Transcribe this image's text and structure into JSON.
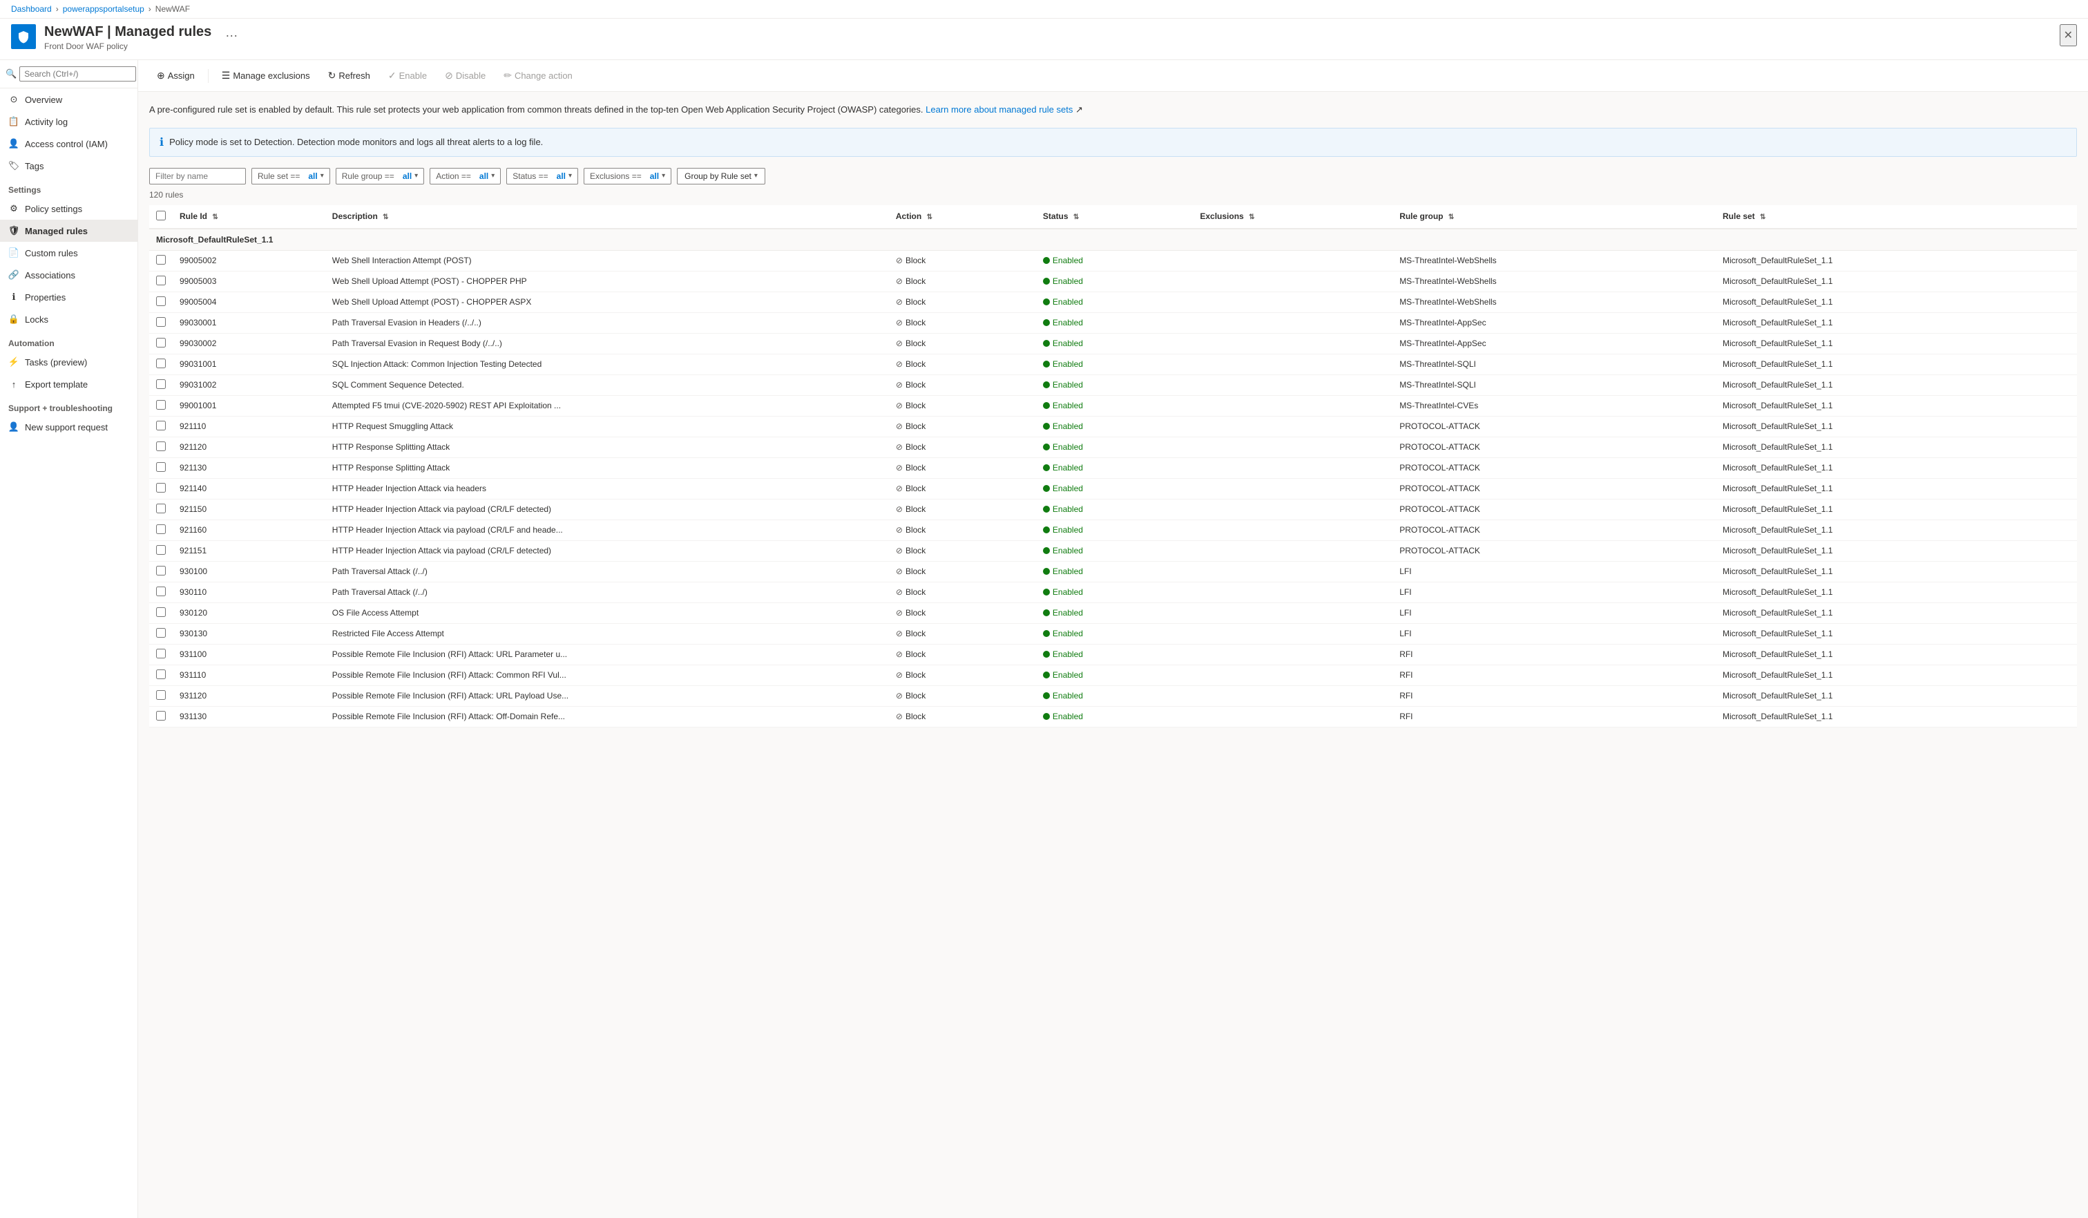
{
  "breadcrumb": {
    "items": [
      "Dashboard",
      "powerappsportalsetup",
      "NewWAF"
    ]
  },
  "header": {
    "title": "NewWAF | Managed rules",
    "subtitle": "Front Door WAF policy",
    "menu_dots": "···"
  },
  "search": {
    "placeholder": "Search (Ctrl+/)"
  },
  "toolbar": {
    "assign_label": "Assign",
    "manage_exclusions_label": "Manage exclusions",
    "refresh_label": "Refresh",
    "enable_label": "Enable",
    "disable_label": "Disable",
    "change_action_label": "Change action"
  },
  "info": {
    "description": "A pre-configured rule set is enabled by default. This rule set protects your web application from common threats defined in the top-ten Open Web Application Security Project (OWASP) categories.",
    "link_text": "Learn more about managed rule sets",
    "alert_text": "Policy mode is set to Detection. Detection mode monitors and logs all threat alerts to a log file."
  },
  "filters": {
    "filter_placeholder": "Filter by name",
    "rule_set_label": "Rule set ==",
    "rule_set_value": "all",
    "rule_group_label": "Rule group ==",
    "rule_group_value": "all",
    "action_label": "Action ==",
    "action_value": "all",
    "status_label": "Status ==",
    "status_value": "all",
    "exclusions_label": "Exclusions ==",
    "exclusions_value": "all",
    "group_by_label": "Group by Rule set"
  },
  "table": {
    "count_text": "120 rules",
    "columns": [
      "Rule Id",
      "Description",
      "Action",
      "Status",
      "Exclusions",
      "Rule group",
      "Rule set"
    ],
    "group_header": "Microsoft_DefaultRuleSet_1.1",
    "rows": [
      {
        "id": "99005002",
        "description": "Web Shell Interaction Attempt (POST)",
        "action": "Block",
        "status": "Enabled",
        "exclusions": "",
        "rule_group": "MS-ThreatIntel-WebShells",
        "rule_set": "Microsoft_DefaultRuleSet_1.1"
      },
      {
        "id": "99005003",
        "description": "Web Shell Upload Attempt (POST) - CHOPPER PHP",
        "action": "Block",
        "status": "Enabled",
        "exclusions": "",
        "rule_group": "MS-ThreatIntel-WebShells",
        "rule_set": "Microsoft_DefaultRuleSet_1.1"
      },
      {
        "id": "99005004",
        "description": "Web Shell Upload Attempt (POST) - CHOPPER ASPX",
        "action": "Block",
        "status": "Enabled",
        "exclusions": "",
        "rule_group": "MS-ThreatIntel-WebShells",
        "rule_set": "Microsoft_DefaultRuleSet_1.1"
      },
      {
        "id": "99030001",
        "description": "Path Traversal Evasion in Headers (/../..)",
        "action": "Block",
        "status": "Enabled",
        "exclusions": "",
        "rule_group": "MS-ThreatIntel-AppSec",
        "rule_set": "Microsoft_DefaultRuleSet_1.1"
      },
      {
        "id": "99030002",
        "description": "Path Traversal Evasion in Request Body (/../..)",
        "action": "Block",
        "status": "Enabled",
        "exclusions": "",
        "rule_group": "MS-ThreatIntel-AppSec",
        "rule_set": "Microsoft_DefaultRuleSet_1.1"
      },
      {
        "id": "99031001",
        "description": "SQL Injection Attack: Common Injection Testing Detected",
        "action": "Block",
        "status": "Enabled",
        "exclusions": "",
        "rule_group": "MS-ThreatIntel-SQLI",
        "rule_set": "Microsoft_DefaultRuleSet_1.1"
      },
      {
        "id": "99031002",
        "description": "SQL Comment Sequence Detected.",
        "action": "Block",
        "status": "Enabled",
        "exclusions": "",
        "rule_group": "MS-ThreatIntel-SQLI",
        "rule_set": "Microsoft_DefaultRuleSet_1.1"
      },
      {
        "id": "99001001",
        "description": "Attempted F5 tmui (CVE-2020-5902) REST API Exploitation ...",
        "action": "Block",
        "status": "Enabled",
        "exclusions": "",
        "rule_group": "MS-ThreatIntel-CVEs",
        "rule_set": "Microsoft_DefaultRuleSet_1.1"
      },
      {
        "id": "921110",
        "description": "HTTP Request Smuggling Attack",
        "action": "Block",
        "status": "Enabled",
        "exclusions": "",
        "rule_group": "PROTOCOL-ATTACK",
        "rule_set": "Microsoft_DefaultRuleSet_1.1"
      },
      {
        "id": "921120",
        "description": "HTTP Response Splitting Attack",
        "action": "Block",
        "status": "Enabled",
        "exclusions": "",
        "rule_group": "PROTOCOL-ATTACK",
        "rule_set": "Microsoft_DefaultRuleSet_1.1"
      },
      {
        "id": "921130",
        "description": "HTTP Response Splitting Attack",
        "action": "Block",
        "status": "Enabled",
        "exclusions": "",
        "rule_group": "PROTOCOL-ATTACK",
        "rule_set": "Microsoft_DefaultRuleSet_1.1"
      },
      {
        "id": "921140",
        "description": "HTTP Header Injection Attack via headers",
        "action": "Block",
        "status": "Enabled",
        "exclusions": "",
        "rule_group": "PROTOCOL-ATTACK",
        "rule_set": "Microsoft_DefaultRuleSet_1.1"
      },
      {
        "id": "921150",
        "description": "HTTP Header Injection Attack via payload (CR/LF detected)",
        "action": "Block",
        "status": "Enabled",
        "exclusions": "",
        "rule_group": "PROTOCOL-ATTACK",
        "rule_set": "Microsoft_DefaultRuleSet_1.1"
      },
      {
        "id": "921160",
        "description": "HTTP Header Injection Attack via payload (CR/LF and heade...",
        "action": "Block",
        "status": "Enabled",
        "exclusions": "",
        "rule_group": "PROTOCOL-ATTACK",
        "rule_set": "Microsoft_DefaultRuleSet_1.1"
      },
      {
        "id": "921151",
        "description": "HTTP Header Injection Attack via payload (CR/LF detected)",
        "action": "Block",
        "status": "Enabled",
        "exclusions": "",
        "rule_group": "PROTOCOL-ATTACK",
        "rule_set": "Microsoft_DefaultRuleSet_1.1"
      },
      {
        "id": "930100",
        "description": "Path Traversal Attack (/../)",
        "action": "Block",
        "status": "Enabled",
        "exclusions": "",
        "rule_group": "LFI",
        "rule_set": "Microsoft_DefaultRuleSet_1.1"
      },
      {
        "id": "930110",
        "description": "Path Traversal Attack (/../)",
        "action": "Block",
        "status": "Enabled",
        "exclusions": "",
        "rule_group": "LFI",
        "rule_set": "Microsoft_DefaultRuleSet_1.1"
      },
      {
        "id": "930120",
        "description": "OS File Access Attempt",
        "action": "Block",
        "status": "Enabled",
        "exclusions": "",
        "rule_group": "LFI",
        "rule_set": "Microsoft_DefaultRuleSet_1.1"
      },
      {
        "id": "930130",
        "description": "Restricted File Access Attempt",
        "action": "Block",
        "status": "Enabled",
        "exclusions": "",
        "rule_group": "LFI",
        "rule_set": "Microsoft_DefaultRuleSet_1.1"
      },
      {
        "id": "931100",
        "description": "Possible Remote File Inclusion (RFI) Attack: URL Parameter u...",
        "action": "Block",
        "status": "Enabled",
        "exclusions": "",
        "rule_group": "RFI",
        "rule_set": "Microsoft_DefaultRuleSet_1.1"
      },
      {
        "id": "931110",
        "description": "Possible Remote File Inclusion (RFI) Attack: Common RFI Vul...",
        "action": "Block",
        "status": "Enabled",
        "exclusions": "",
        "rule_group": "RFI",
        "rule_set": "Microsoft_DefaultRuleSet_1.1"
      },
      {
        "id": "931120",
        "description": "Possible Remote File Inclusion (RFI) Attack: URL Payload Use...",
        "action": "Block",
        "status": "Enabled",
        "exclusions": "",
        "rule_group": "RFI",
        "rule_set": "Microsoft_DefaultRuleSet_1.1"
      },
      {
        "id": "931130",
        "description": "Possible Remote File Inclusion (RFI) Attack: Off-Domain Refe...",
        "action": "Block",
        "status": "Enabled",
        "exclusions": "",
        "rule_group": "RFI",
        "rule_set": "Microsoft_DefaultRuleSet_1.1"
      }
    ]
  },
  "sidebar": {
    "search_placeholder": "Search (Ctrl+/)",
    "nav_items": [
      {
        "id": "overview",
        "label": "Overview",
        "icon": "home"
      },
      {
        "id": "activity-log",
        "label": "Activity log",
        "icon": "activity"
      },
      {
        "id": "access-control",
        "label": "Access control (IAM)",
        "icon": "person"
      },
      {
        "id": "tags",
        "label": "Tags",
        "icon": "tag"
      }
    ],
    "settings_label": "Settings",
    "settings_items": [
      {
        "id": "policy-settings",
        "label": "Policy settings",
        "icon": "settings"
      },
      {
        "id": "managed-rules",
        "label": "Managed rules",
        "icon": "shield",
        "active": true
      },
      {
        "id": "custom-rules",
        "label": "Custom rules",
        "icon": "rule"
      },
      {
        "id": "associations",
        "label": "Associations",
        "icon": "link"
      },
      {
        "id": "properties",
        "label": "Properties",
        "icon": "info"
      },
      {
        "id": "locks",
        "label": "Locks",
        "icon": "lock"
      }
    ],
    "automation_label": "Automation",
    "automation_items": [
      {
        "id": "tasks",
        "label": "Tasks (preview)",
        "icon": "task"
      },
      {
        "id": "export",
        "label": "Export template",
        "icon": "export"
      }
    ],
    "support_label": "Support + troubleshooting",
    "support_items": [
      {
        "id": "support",
        "label": "New support request",
        "icon": "support"
      }
    ]
  }
}
